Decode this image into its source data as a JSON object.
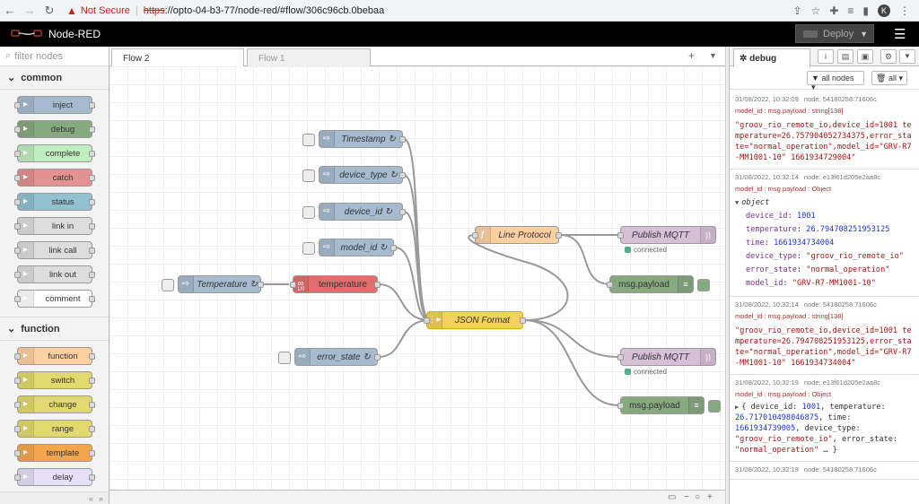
{
  "browser": {
    "security": "Not Secure",
    "url_scheme": "https",
    "url_rest": "://opto-04-b3-77/node-red/#flow/306c96cb.0bebaa",
    "avatar_letter": "K"
  },
  "header": {
    "app_title": "Node-RED",
    "deploy_label": "Deploy"
  },
  "palette": {
    "filter_placeholder": "filter nodes",
    "categories": [
      {
        "name": "common",
        "nodes": [
          {
            "label": "inject",
            "color": "#a6bbcf"
          },
          {
            "label": "debug",
            "color": "#87a980"
          },
          {
            "label": "complete",
            "color": "#c0edc0"
          },
          {
            "label": "catch",
            "color": "#e49191"
          },
          {
            "label": "status",
            "color": "#94c1d0"
          },
          {
            "label": "link in",
            "color": "#dddddd"
          },
          {
            "label": "link call",
            "color": "#dddddd"
          },
          {
            "label": "link out",
            "color": "#dddddd"
          },
          {
            "label": "comment",
            "color": "#ffffff"
          }
        ]
      },
      {
        "name": "function",
        "nodes": [
          {
            "label": "function",
            "color": "#fdd0a2"
          },
          {
            "label": "switch",
            "color": "#e2d96e"
          },
          {
            "label": "change",
            "color": "#e2d96e"
          },
          {
            "label": "range",
            "color": "#e2d96e"
          },
          {
            "label": "template",
            "color": "#f2a74e"
          },
          {
            "label": "delay",
            "color": "#e6e0f8"
          }
        ]
      }
    ]
  },
  "workspace": {
    "tabs": [
      {
        "label": "Flow 2",
        "active": true
      },
      {
        "label": "Flow 1",
        "active": false
      }
    ],
    "nodes": {
      "timestamp": "Timestamp ↻",
      "device_type": "device_type ↻",
      "device_id": "device_id ↻",
      "model_id": "model_id ↻",
      "temperature_inject": "Temperature ↻",
      "temperature": "temperature",
      "temperature_badge": "1/0",
      "error_state": "error_state ↻",
      "line_protocol": "Line Protocol",
      "json_format": "JSON Format",
      "publish_mqtt_1": "Publish MQTT",
      "publish_mqtt_2": "Publish MQTT",
      "msg_payload_1": "msg.payload",
      "msg_payload_2": "msg.payload",
      "status_connected_1": "connected",
      "status_connected_2": "connected"
    },
    "colors": {
      "inject": "#a6bbcf",
      "function": "#fdd0a2",
      "template": "#f3d15e",
      "mqtt": "#d8bfd8",
      "debug": "#87a980",
      "subflow": "#e16e6e"
    }
  },
  "sidebar": {
    "tab_label": "debug",
    "filter_nodes": "all nodes",
    "filter_clear": "all",
    "messages": [
      {
        "time": "31/08/2022, 10:32:09",
        "node": "node: 54180258.71606c",
        "topic": "model_id : msg.payload : string[138]",
        "payload": "\"groov_rio_remote_io,device_id=1001 temperature=26.757904052734375,error_state=\"normal_operation\",model_id=\"GRV-R7-MM1001-10\" 1661934729004\""
      },
      {
        "time": "31/08/2022, 10:32:14",
        "node": "node: e13f61d205e2aa8c",
        "topic": "model_id : msg.payload : Object",
        "object_label": "object",
        "fields": [
          {
            "key": "device_id",
            "value": "1001",
            "kind": "num"
          },
          {
            "key": "temperature",
            "value": "26.794708251953125",
            "kind": "num"
          },
          {
            "key": "time",
            "value": "1661934734004",
            "kind": "num"
          },
          {
            "key": "device_type",
            "value": "\"groov_rio_remote_io\"",
            "kind": "str"
          },
          {
            "key": "error_state",
            "value": "\"normal_operation\"",
            "kind": "str"
          },
          {
            "key": "model_id",
            "value": "\"GRV-R7-MM1001-10\"",
            "kind": "str"
          }
        ]
      },
      {
        "time": "31/08/2022, 10:32:14",
        "node": "node: 54180258.71606c",
        "topic": "model_id : msg.payload : string[138]",
        "payload": "\"groov_rio_remote_io,device_id=1001 temperature=26.794708251953125,error_state=\"normal_operation\",model_id=\"GRV-R7-MM1001-10\" 1661934734004\""
      },
      {
        "time": "31/08/2022, 10:32:19",
        "node": "node: e13f61d205e2aa8c",
        "topic": "model_id : msg.payload : Object",
        "collapsed_p1": "{ device_id: ",
        "collapsed_v1": "1001",
        "collapsed_p2": ", temperature: ",
        "collapsed_v2": "26.717010498046875",
        "collapsed_p3": ", time: ",
        "collapsed_v3": "1661934739005",
        "collapsed_p4": ", device_type: ",
        "collapsed_v4": "\"groov_rio_remote_io\"",
        "collapsed_p5": ", error_state: ",
        "collapsed_v5": "\"normal_operation\"",
        "collapsed_p6": " … }"
      },
      {
        "time": "31/08/2022, 10:32:19",
        "node": "node: 54180258.71606c"
      }
    ]
  }
}
